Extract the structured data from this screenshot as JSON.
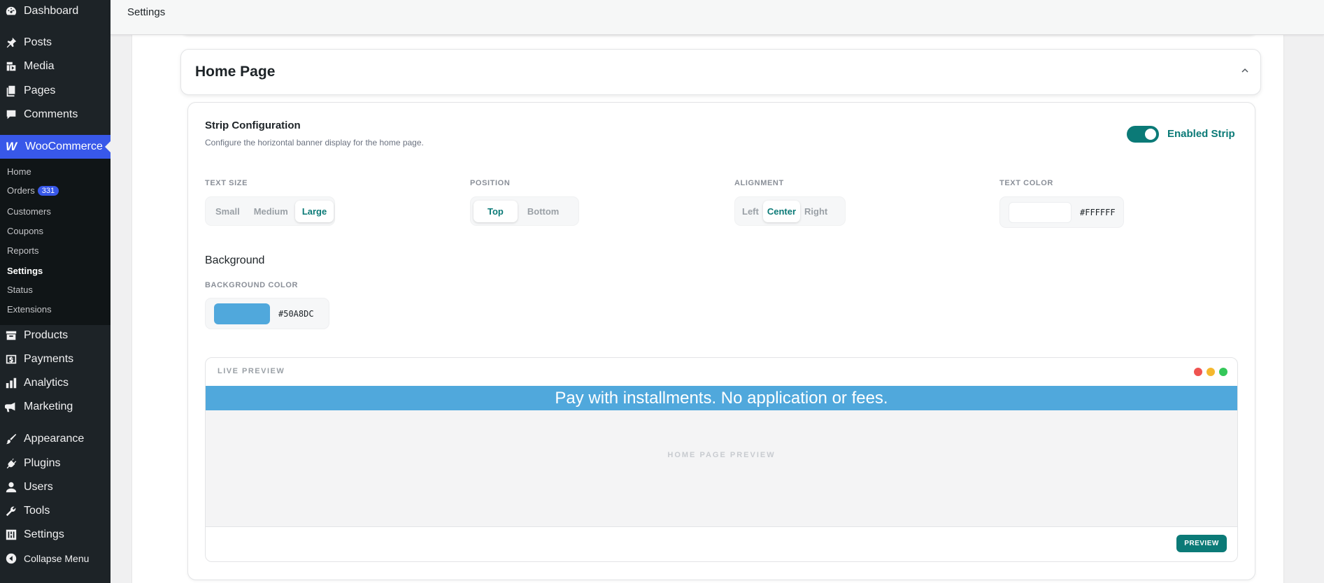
{
  "sidebar": {
    "menu_top": [
      {
        "label": "Dashboard",
        "icon": "dashboard-icon"
      },
      {
        "label": "Posts",
        "icon": "pin-icon"
      },
      {
        "label": "Media",
        "icon": "media-icon"
      },
      {
        "label": "Pages",
        "icon": "pages-icon"
      },
      {
        "label": "Comments",
        "icon": "comment-icon"
      }
    ],
    "woocommerce": {
      "label": "WooCommerce",
      "logo": "W"
    },
    "submenu": [
      {
        "label": "Home"
      },
      {
        "label": "Orders",
        "badge": "331"
      },
      {
        "label": "Customers"
      },
      {
        "label": "Coupons"
      },
      {
        "label": "Reports"
      },
      {
        "label": "Settings",
        "current": true
      },
      {
        "label": "Status"
      },
      {
        "label": "Extensions"
      }
    ],
    "menu_bottom": [
      {
        "label": "Products",
        "icon": "archive-icon"
      },
      {
        "label": "Payments",
        "icon": "payments-icon"
      },
      {
        "label": "Analytics",
        "icon": "bar-chart-icon"
      },
      {
        "label": "Marketing",
        "icon": "megaphone-icon"
      },
      {
        "label": "Appearance",
        "icon": "brush-icon"
      },
      {
        "label": "Plugins",
        "icon": "plug-icon"
      },
      {
        "label": "Users",
        "icon": "user-icon"
      },
      {
        "label": "Tools",
        "icon": "wrench-icon"
      },
      {
        "label": "Settings",
        "icon": "sliders-icon"
      },
      {
        "label": "Collapse Menu",
        "icon": "collapse-icon"
      }
    ]
  },
  "topbar": {
    "title": "Settings"
  },
  "section": {
    "title": "Home Page",
    "strip": {
      "title": "Strip Configuration",
      "description": "Configure the horizontal banner display for the home page.",
      "toggle_label": "Enabled Strip",
      "enabled": true
    },
    "text_size": {
      "label": "TEXT SIZE",
      "options": [
        "Small",
        "Medium",
        "Large"
      ],
      "selected": "Large"
    },
    "position": {
      "label": "POSITION",
      "options": [
        "Top",
        "Bottom"
      ],
      "selected": "Top"
    },
    "alignment": {
      "label": "ALIGNMENT",
      "options": [
        "Left",
        "Center",
        "Right"
      ],
      "selected": "Center"
    },
    "text_color": {
      "label": "TEXT COLOR",
      "value": "#FFFFFF",
      "color": "#FFFFFF"
    },
    "background": {
      "title": "Background",
      "label": "BACKGROUND COLOR",
      "value": "#50A8DC",
      "color": "#50A8DC"
    },
    "preview": {
      "label": "LIVE PREVIEW",
      "strip_text": "Pay with installments. No application or fees.",
      "placeholder": "HOME PAGE PREVIEW",
      "button": "PREVIEW"
    }
  },
  "colors": {
    "accent": "#0b7a77",
    "wp_sidebar": "#1d2327",
    "wp_active": "#3858e9",
    "dot_red": "#ef5350",
    "dot_yellow": "#f5b82e",
    "dot_green": "#34c759"
  }
}
